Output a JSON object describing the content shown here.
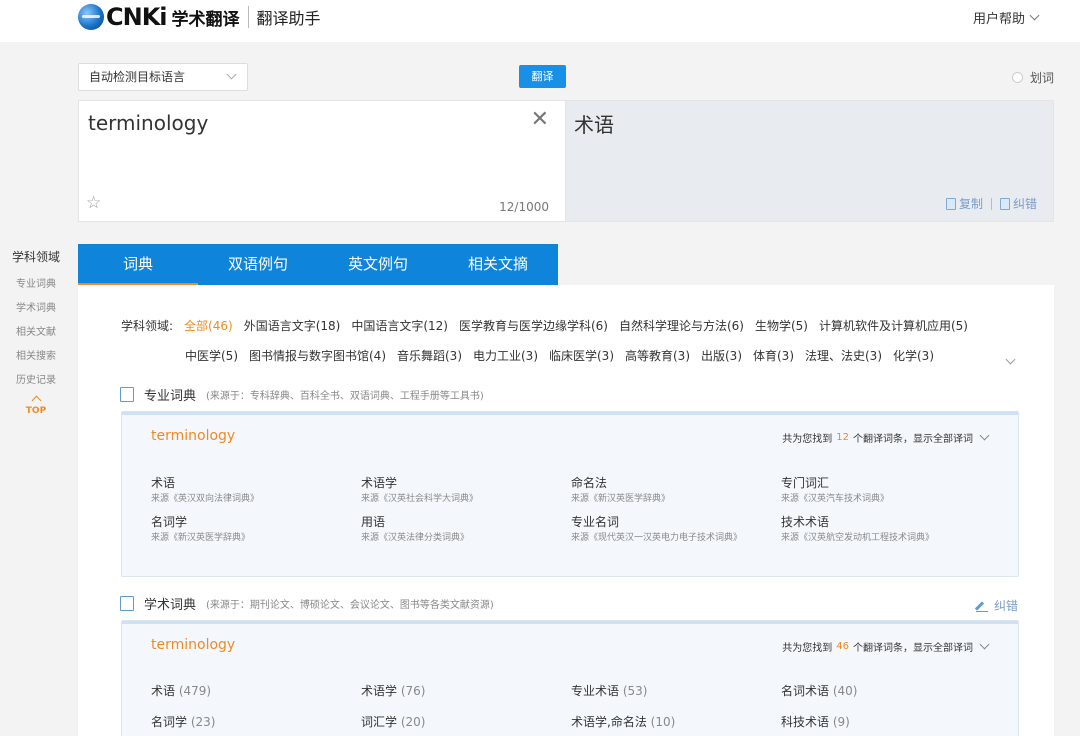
{
  "header": {
    "logo_text": "CNKi",
    "brand": "学术翻译",
    "subtitle": "翻译助手",
    "help": "用户帮助"
  },
  "toolbar": {
    "lang_select": "自动检测目标语言",
    "translate_button": "翻译",
    "huaci": "划词"
  },
  "source": {
    "text": "terminology",
    "counter": "12/1000"
  },
  "target": {
    "text": "术语",
    "copy": "复制",
    "correct": "纠错"
  },
  "sidebar": {
    "title": "学科领域",
    "items": [
      "专业词典",
      "学术词典",
      "相关文献",
      "相关搜索",
      "历史记录"
    ],
    "top": "TOP"
  },
  "tabs": [
    "词典",
    "双语例句",
    "英文例句",
    "相关文摘"
  ],
  "subjects": {
    "label": "学科领域:",
    "row1": [
      "全部(46)",
      "外国语言文字(18)",
      "中国语言文字(12)",
      "医学教育与医学边缘学科(6)",
      "自然科学理论与方法(6)",
      "生物学(5)",
      "计算机软件及计算机应用(5)"
    ],
    "row2": [
      "中医学(5)",
      "图书情报与数字图书馆(4)",
      "音乐舞蹈(3)",
      "电力工业(3)",
      "临床医学(3)",
      "高等教育(3)",
      "出版(3)",
      "体育(3)",
      "法理、法史(3)",
      "化学(3)"
    ]
  },
  "pro_dict": {
    "name": "专业词典",
    "source": "(来源于：专科辞典、百科全书、双语词典、工程手册等工具书)",
    "term": "terminology",
    "count_prefix": "共为您找到",
    "count": "12",
    "count_suffix": "个翻译词条，显示全部译词",
    "entries": [
      {
        "term": "术语",
        "src": "来源《英汉双向法律词典》"
      },
      {
        "term": "术语学",
        "src": "来源《汉英社会科学大词典》"
      },
      {
        "term": "命名法",
        "src": "来源《新汉英医学辞典》"
      },
      {
        "term": "专门词汇",
        "src": "来源《汉英汽车技术词典》"
      },
      {
        "term": "名词学",
        "src": "来源《新汉英医学辞典》"
      },
      {
        "term": "用语",
        "src": "来源《汉英法律分类词典》"
      },
      {
        "term": "专业名词",
        "src": "来源《现代英汉一汉英电力电子技术词典》"
      },
      {
        "term": "技术术语",
        "src": "来源《汉英航空发动机工程技术词典》"
      }
    ]
  },
  "acad_dict": {
    "name": "学术词典",
    "source": "(来源于：期刊论文、博硕论文、会议论文、图书等各类文献资源)",
    "correct": "纠错",
    "term": "terminology",
    "count_prefix": "共为您找到",
    "count": "46",
    "count_suffix": "个翻译词条，显示全部译词",
    "entries": [
      {
        "term": "术语",
        "count": "(479)"
      },
      {
        "term": "术语学",
        "count": "(76)"
      },
      {
        "term": "专业术语",
        "count": "(53)"
      },
      {
        "term": "名词术语",
        "count": "(40)"
      },
      {
        "term": "名词学",
        "count": "(23)"
      },
      {
        "term": "词汇学",
        "count": "(20)"
      },
      {
        "term": "术语学,命名法",
        "count": "(10)"
      },
      {
        "term": "科技术语",
        "count": "(9)"
      }
    ]
  }
}
